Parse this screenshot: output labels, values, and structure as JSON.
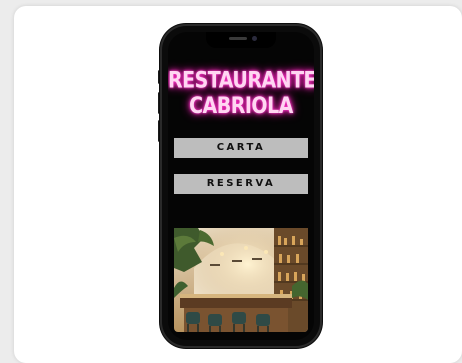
{
  "app": {
    "title_line1": "RESTAURANTE",
    "title_line2": "CABRIOLA",
    "title_color": "#ff2bc2"
  },
  "menu": {
    "carta_label": "CARTA",
    "reserva_label": "RESERVA",
    "button_bg": "#bdbdbd"
  },
  "image": {
    "subject": "restaurant-interior-photo"
  }
}
